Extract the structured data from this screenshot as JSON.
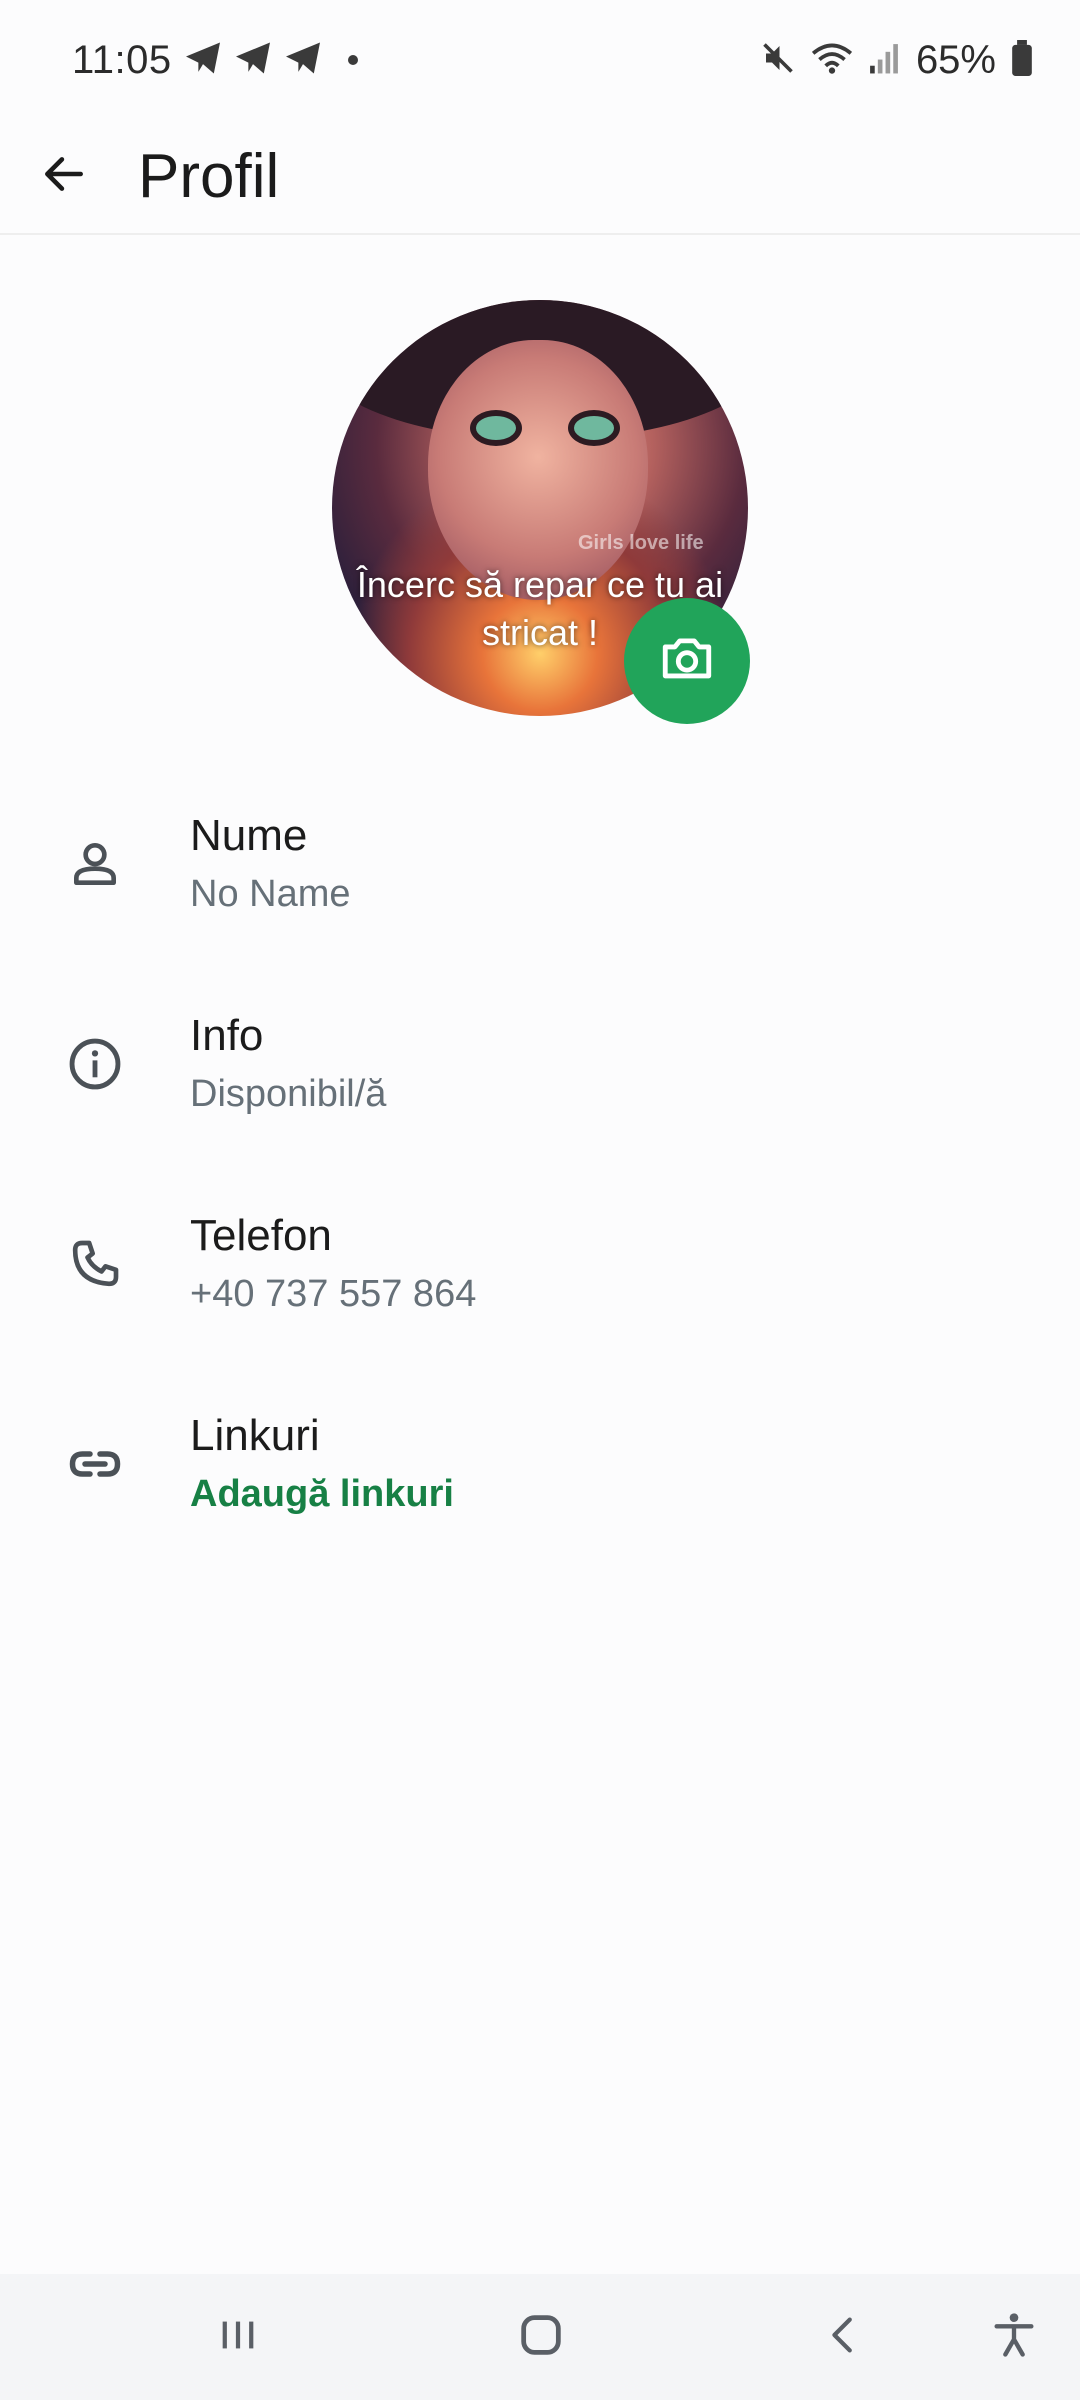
{
  "status_bar": {
    "time": "11:05",
    "battery_percent": "65%",
    "icons": [
      "telegram-icon",
      "telegram-icon",
      "telegram-icon",
      "notification-dot",
      "mute-icon",
      "wifi-icon",
      "signal-icon",
      "battery-icon"
    ]
  },
  "app_bar": {
    "title": "Profil",
    "back_icon": "arrow-left-icon"
  },
  "profile_photo": {
    "caption_line1": "Încerc să repar ce tu ai",
    "caption_line2": "stricat !",
    "watermark": "Girls love life",
    "camera_icon": "camera-icon"
  },
  "fields": [
    {
      "icon": "person-icon",
      "label": "Nume",
      "value": "No Name"
    },
    {
      "icon": "info-icon",
      "label": "Info",
      "value": "Disponibil/ă"
    },
    {
      "icon": "phone-icon",
      "label": "Telefon",
      "value": "+40 737 557 864"
    },
    {
      "icon": "link-icon",
      "label": "Linkuri",
      "value": "Adaugă linkuri"
    }
  ],
  "nav_bar": {
    "buttons": [
      "recent-apps-icon",
      "home-icon",
      "back-icon",
      "accessibility-icon"
    ]
  },
  "colors": {
    "accent": "#21a45a",
    "link_text": "#178045",
    "secondary_text": "#667078",
    "background": "#fcfcfd"
  }
}
